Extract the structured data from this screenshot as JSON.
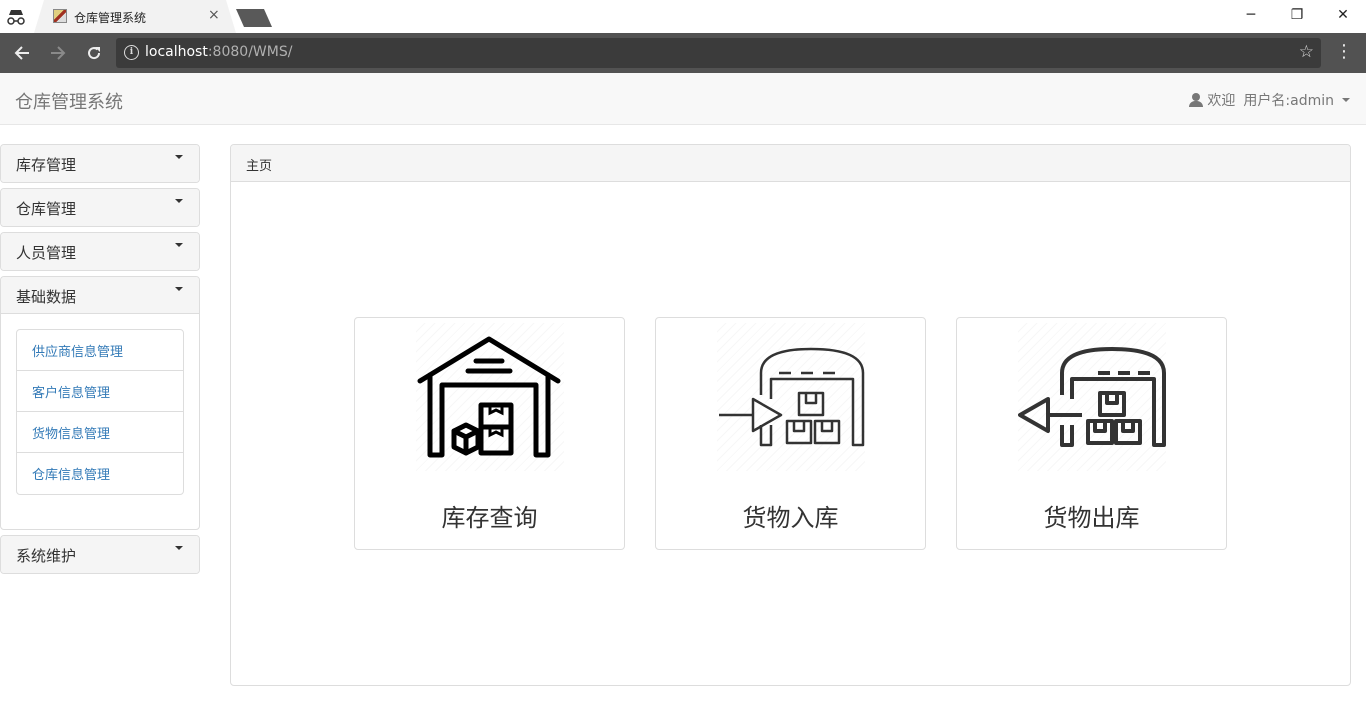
{
  "browser": {
    "tab_title": "仓库管理系统",
    "tab_close": "×",
    "url_host": "localhost",
    "url_rest": ":8080/WMS/",
    "window_controls": [
      "─",
      "❐",
      "✕"
    ]
  },
  "navbar": {
    "brand": "仓库管理系统",
    "welcome": "欢迎",
    "username": "用户名:admin"
  },
  "sidebar": {
    "items": [
      {
        "label": "库存管理"
      },
      {
        "label": "仓库管理"
      },
      {
        "label": "人员管理"
      },
      {
        "label": "基础数据",
        "sub": [
          "供应商信息管理",
          "客户信息管理",
          "货物信息管理",
          "仓库信息管理"
        ]
      },
      {
        "label": "系统维护"
      }
    ]
  },
  "main": {
    "breadcrumb": "主页",
    "cards": [
      {
        "label": "库存查询",
        "icon": "warehouse-icon"
      },
      {
        "label": "货物入库",
        "icon": "stock-in-icon"
      },
      {
        "label": "货物出库",
        "icon": "stock-out-icon"
      }
    ]
  }
}
